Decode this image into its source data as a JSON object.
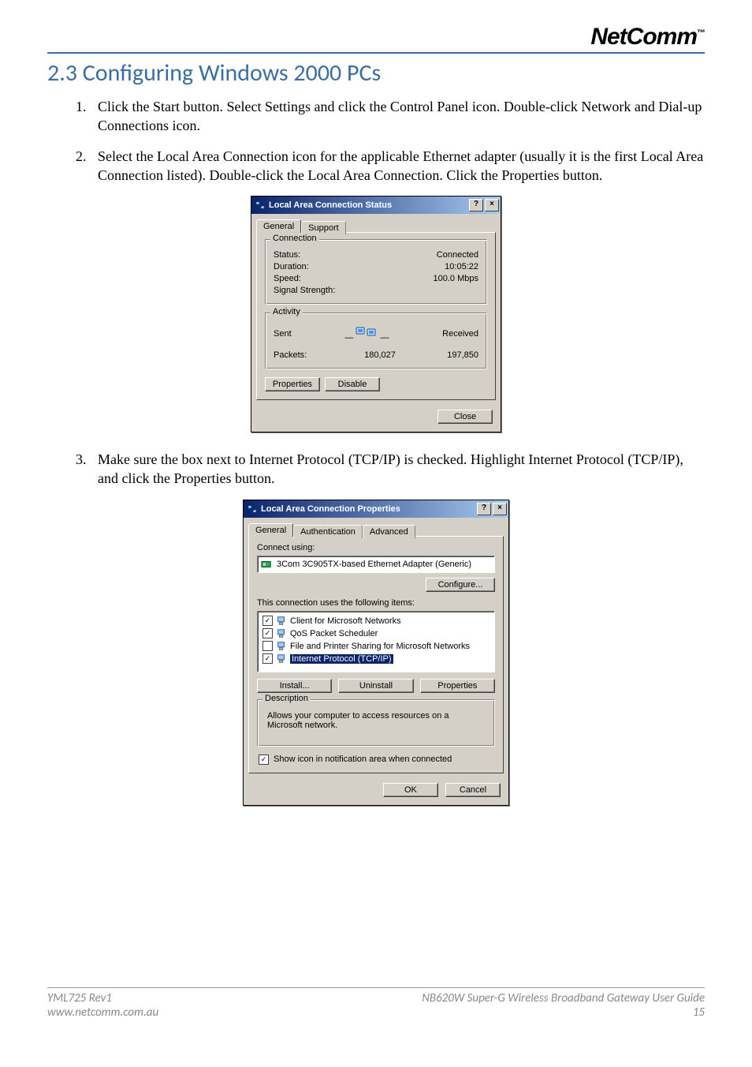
{
  "brand": {
    "name": "NetComm",
    "tm": "™"
  },
  "section": {
    "title": "2.3 Configuring Windows 2000 PCs"
  },
  "steps": [
    "Click the Start button. Select Settings and click the Control Panel icon. Double-click Network and Dial-up Connections icon.",
    "Select the Local Area Connection icon for the applicable Ethernet adapter (usually it is the first Local Area Connection listed). Double-click the Local Area Connection. Click the Properties button.",
    "Make sure the box next to Internet Protocol (TCP/IP) is checked. Highlight Internet Protocol (TCP/IP), and click the Properties button."
  ],
  "dialog1": {
    "title": "Local Area Connection Status",
    "help": "?",
    "close": "×",
    "tabs": {
      "general": "General",
      "support": "Support"
    },
    "connection": {
      "legend": "Connection",
      "status_label": "Status:",
      "status_value": "Connected",
      "duration_label": "Duration:",
      "duration_value": "10:05:22",
      "speed_label": "Speed:",
      "speed_value": "100.0 Mbps",
      "signal_label": "Signal Strength:"
    },
    "activity": {
      "legend": "Activity",
      "sent": "Sent",
      "dash": "—",
      "received": "Received",
      "packets_label": "Packets:",
      "sent_value": "180,027",
      "received_value": "197,850"
    },
    "buttons": {
      "properties": "Properties",
      "disable": "Disable",
      "close": "Close"
    }
  },
  "dialog2": {
    "title": "Local Area Connection Properties",
    "help": "?",
    "close": "×",
    "tabs": {
      "general": "General",
      "authentication": "Authentication",
      "advanced": "Advanced"
    },
    "connect_using_label": "Connect using:",
    "adapter": "3Com 3C905TX-based Ethernet Adapter (Generic)",
    "configure": "Configure...",
    "items_label": "This connection uses the following items:",
    "items": [
      {
        "checked": true,
        "name": "Client for Microsoft Networks",
        "selected": false
      },
      {
        "checked": true,
        "name": "QoS Packet Scheduler",
        "selected": false
      },
      {
        "checked": false,
        "name": "File and Printer Sharing for Microsoft Networks",
        "selected": false
      },
      {
        "checked": true,
        "name": "Internet Protocol (TCP/IP)",
        "selected": true
      }
    ],
    "buttons": {
      "install": "Install...",
      "uninstall": "Uninstall",
      "properties": "Properties"
    },
    "description": {
      "legend": "Description",
      "text": "Allows your computer to access resources on a Microsoft network."
    },
    "show_icon": "Show icon in notification area when connected",
    "ok": "OK",
    "cancel": "Cancel"
  },
  "footer": {
    "left1": "YML725 Rev1",
    "left2": "www.netcomm.com.au",
    "right1": "NB620W Super-G Wireless Broadband  Gateway User Guide",
    "right2": "15"
  }
}
